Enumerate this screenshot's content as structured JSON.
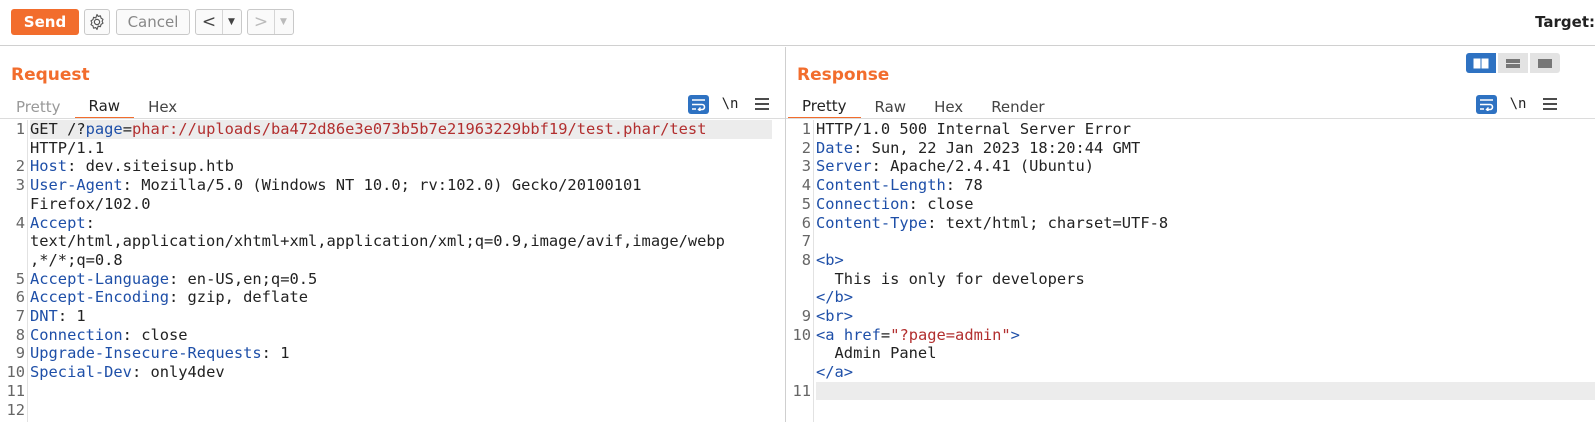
{
  "toolbar": {
    "send_label": "Send",
    "cancel_label": "Cancel",
    "back_arrow": "<",
    "forward_arrow": ">",
    "dropdown_glyph": "▼",
    "target_label": "Target:"
  },
  "colors": {
    "accent": "#f26d2d",
    "key_blue": "#1e4fa8",
    "value_red": "#b22f2f",
    "toggle_blue": "#2e72c2"
  },
  "icons": {
    "gear": "gear-icon",
    "wrap": "text-wrap-icon",
    "newline": "newline-icon",
    "menu": "hamburger-menu-icon",
    "layout": [
      "layout-side-by-side-icon",
      "layout-top-bottom-icon",
      "layout-single-icon"
    ]
  },
  "request": {
    "title": "Request",
    "tabs": [
      {
        "label": "Pretty"
      },
      {
        "label": "Raw"
      },
      {
        "label": "Hex"
      }
    ],
    "active_tab": "Raw",
    "newline_label": "\\n",
    "line_numbers": [
      "1",
      "2",
      "3",
      "4",
      "5",
      "6",
      "7",
      "8",
      "9",
      "10",
      "11",
      "12"
    ],
    "lines": {
      "l1_method": "GET /?",
      "l1_param": "page",
      "l1_eq": "=",
      "l1_value": "phar://uploads/ba472d86e3e073b5b7e21963229bbf19/test.phar/test",
      "l1_cont": "HTTP/1.1",
      "l2_key": "Host",
      "l2_val": ": dev.siteisup.htb",
      "l3_key": "User-Agent",
      "l3_val": ": Mozilla/5.0 (Windows NT 10.0; rv:102.0) Gecko/20100101",
      "l3_cont": "Firefox/102.0",
      "l4_key": "Accept",
      "l4_val": ":",
      "l4_cont1": "text/html,application/xhtml+xml,application/xml;q=0.9,image/avif,image/webp",
      "l4_cont2": ",*/*;q=0.8",
      "l5_key": "Accept-Language",
      "l5_val": ": en-US,en;q=0.5",
      "l6_key": "Accept-Encoding",
      "l6_val": ": gzip, deflate",
      "l7_key": "DNT",
      "l7_val": ": 1",
      "l8_key": "Connection",
      "l8_val": ": close",
      "l9_key": "Upgrade-Insecure-Requests",
      "l9_val": ": 1",
      "l10_key": "Special-Dev",
      "l10_val": ": only4dev"
    }
  },
  "response": {
    "title": "Response",
    "tabs": [
      {
        "label": "Pretty"
      },
      {
        "label": "Raw"
      },
      {
        "label": "Hex"
      },
      {
        "label": "Render"
      }
    ],
    "active_tab": "Pretty",
    "newline_label": "\\n",
    "line_numbers": [
      "1",
      "2",
      "3",
      "4",
      "5",
      "6",
      "7",
      "8",
      "9",
      "10",
      "11"
    ],
    "lines": {
      "l1": "HTTP/1.0 500 Internal Server Error",
      "l2_key": "Date",
      "l2_val": ": Sun, 22 Jan 2023 18:20:44 GMT",
      "l3_key": "Server",
      "l3_val": ": Apache/2.4.41 (Ubuntu)",
      "l4_key": "Content-Length",
      "l4_val": ": 78",
      "l5_key": "Connection",
      "l5_val": ": close",
      "l6_key": "Content-Type",
      "l6_val": ": text/html; charset=UTF-8",
      "l8_open_b": "<b>",
      "l8_text": "  This is only for developers",
      "l8_close_b": "</b>",
      "l9_br": "<br>",
      "l10_open_a": "<a",
      "l10_attr": "href",
      "l10_eq": "=",
      "l10_attr_val": "\"?page=admin\"",
      "l10_gt": ">",
      "l10_text": "  Admin Panel",
      "l10_close_a": "</a>"
    }
  }
}
